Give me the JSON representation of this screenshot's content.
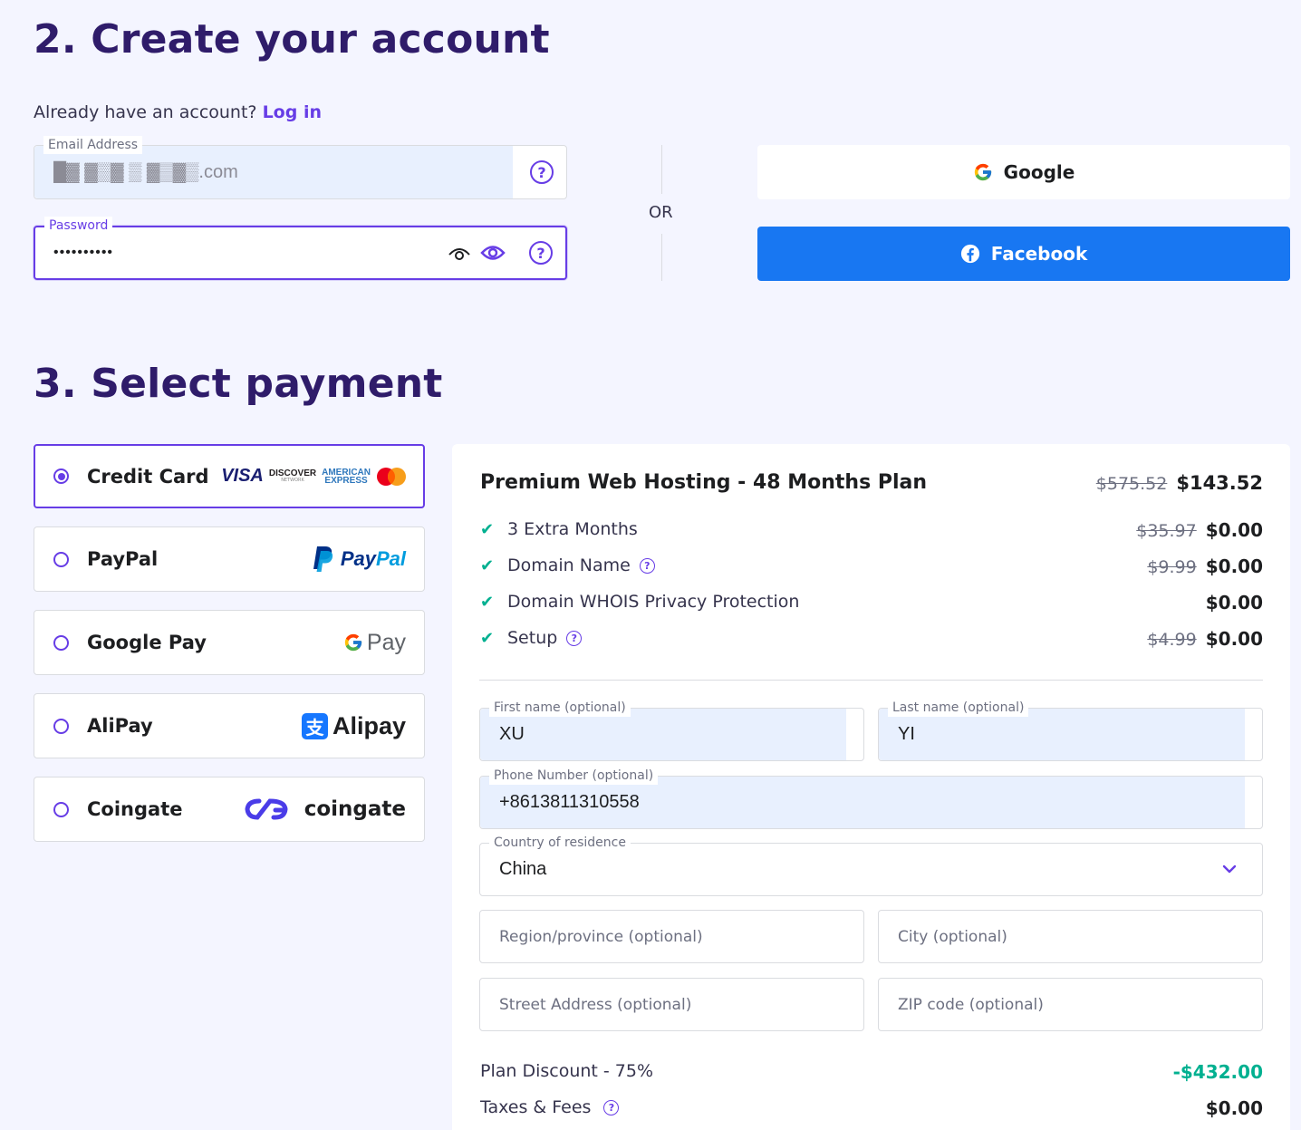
{
  "account": {
    "heading": "2. Create your account",
    "already_text": "Already have an account?",
    "login_link": "Log in",
    "email_label": "Email Address",
    "email_value": "█▓ ▓▒▓ ▒ ▓▒▓▒.com",
    "password_label": "Password",
    "password_value": "••••••••••",
    "or_text": "OR",
    "google_label": "Google",
    "facebook_label": "Facebook"
  },
  "payment": {
    "heading": "3. Select payment",
    "methods": [
      {
        "label": "Credit Card",
        "selected": true
      },
      {
        "label": "PayPal",
        "selected": false
      },
      {
        "label": "Google Pay",
        "selected": false
      },
      {
        "label": "AliPay",
        "selected": false
      },
      {
        "label": "Coingate",
        "selected": false
      }
    ],
    "logos": {
      "visa": "VISA",
      "discover": "DISCOVER",
      "discover_sub": "NETWORK",
      "amex_top": "AMERICAN",
      "amex_bottom": "EXPRESS",
      "paypal": "PayPal",
      "gpay": "Pay",
      "alipay": "Alipay",
      "coingate": "coingate"
    }
  },
  "summary": {
    "plan_title": "Premium Web Hosting - 48 Months Plan",
    "plan_old_price": "$575.52",
    "plan_price": "$143.52",
    "items": [
      {
        "label": "3 Extra Months",
        "old": "$35.97",
        "price": "$0.00",
        "help": false
      },
      {
        "label": "Domain Name",
        "old": "$9.99",
        "price": "$0.00",
        "help": true
      },
      {
        "label": "Domain WHOIS Privacy Protection",
        "old": "",
        "price": "$0.00",
        "help": false
      },
      {
        "label": "Setup",
        "old": "$4.99",
        "price": "$0.00",
        "help": true
      }
    ],
    "form": {
      "first_name_label": "First name (optional)",
      "first_name_value": "XU",
      "last_name_label": "Last name (optional)",
      "last_name_value": "YI",
      "phone_label": "Phone Number (optional)",
      "phone_value": "+8613811310558",
      "country_label": "Country of residence",
      "country_value": "China",
      "region_placeholder": "Region/province (optional)",
      "city_placeholder": "City (optional)",
      "street_placeholder": "Street Address (optional)",
      "zip_placeholder": "ZIP code (optional)"
    },
    "discount_label": "Plan Discount - 75%",
    "discount_value": "-$432.00",
    "taxes_label": "Taxes & Fees",
    "taxes_value": "$0.00"
  },
  "colors": {
    "primary": "#673de6",
    "heading": "#2f1c6a",
    "facebook": "#1877f2",
    "success": "#00b090"
  }
}
